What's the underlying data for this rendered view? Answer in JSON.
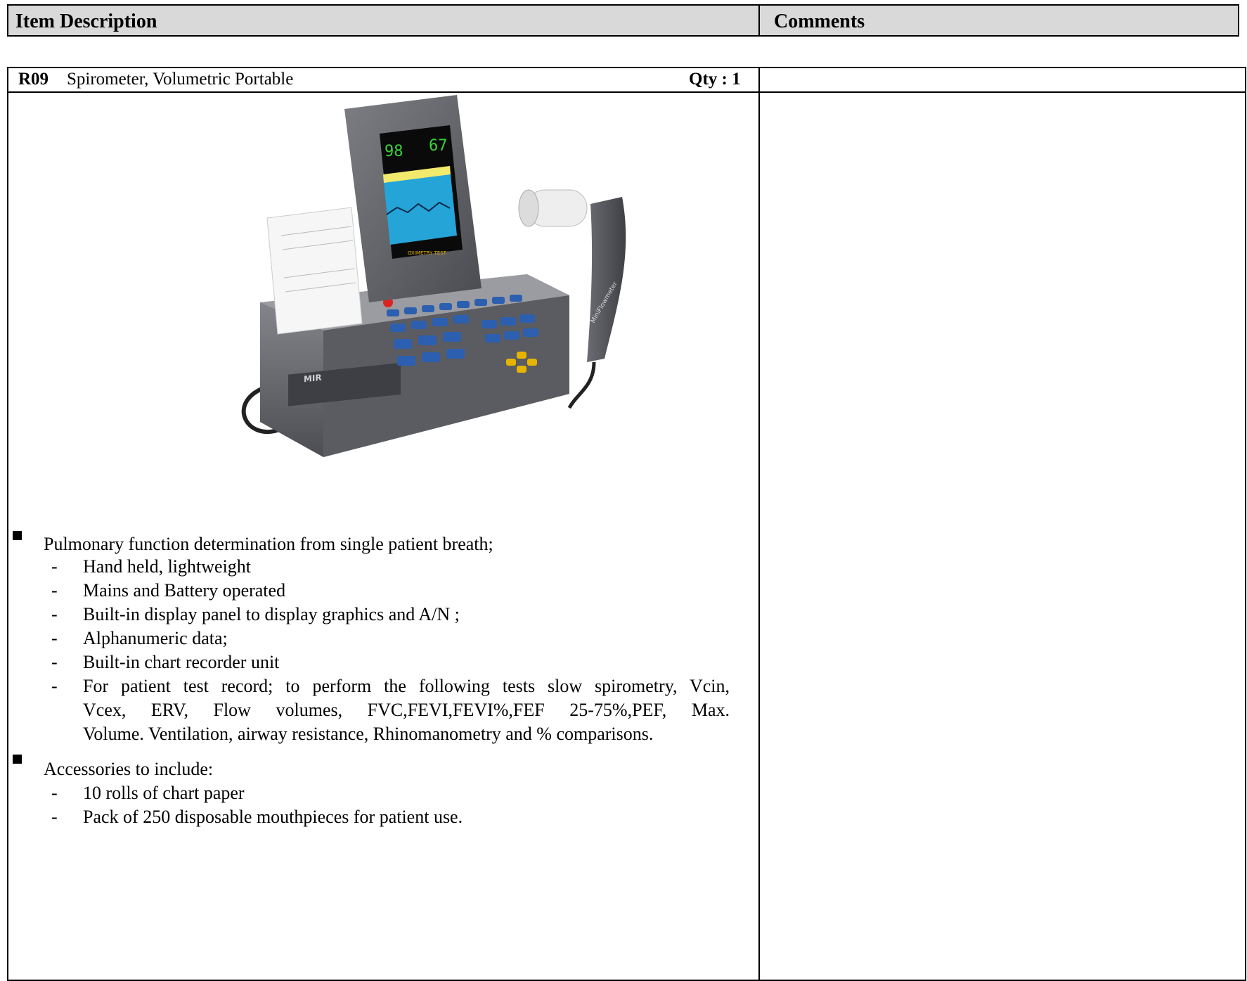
{
  "header": {
    "col1": "Item Description",
    "col2": "Comments"
  },
  "item": {
    "code": "R09",
    "name": "Spirometer, Volumetric Portable",
    "qty": "Qty : 1",
    "features": {
      "heading": "Pulmonary function determination from single patient breath;",
      "items": [
        "Hand held, lightweight",
        "Mains and Battery operated",
        "Built-in display panel to display graphics and A/N ;",
        "Alphanumeric data;",
        "Built-in chart recorder unit",
        "For patient test record; to perform the following tests slow spirometry, Vcin,",
        "Vcex, ERV, Flow volumes, FVC,FEVI,FEVI%,FEF 25-75%,PEF, Max.",
        "Volume. Ventilation, airway resistance, Rhinomanometry and % comparisons."
      ]
    },
    "accessories": {
      "heading": "Accessories to include:",
      "items": [
        "10 rolls of chart paper",
        "Pack of 250 disposable mouthpieces for patient use."
      ]
    }
  },
  "device_display": {
    "spo2": "98",
    "heart_rate": "67",
    "screen_caption": "OXIMETRY TEST",
    "brand": "MIR",
    "meter_brand": "MiniFlowmeter"
  }
}
